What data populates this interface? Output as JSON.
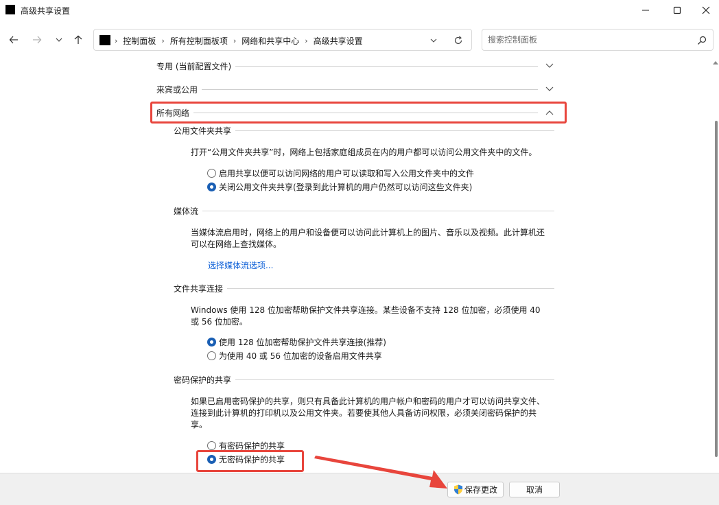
{
  "window": {
    "title": "高级共享设置"
  },
  "breadcrumb": [
    "控制面板",
    "所有控制面板项",
    "网络和共享中心",
    "高级共享设置"
  ],
  "search": {
    "placeholder": "搜索控制面板"
  },
  "profiles": {
    "private_label": "专用 (当前配置文件)",
    "guest_label": "来宾或公用",
    "all_label": "所有网络"
  },
  "public_folder": {
    "heading": "公用文件夹共享",
    "desc": "打开“公用文件夹共享”时，网络上包括家庭组成员在内的用户都可以访问公用文件夹中的文件。",
    "opt_on": "启用共享以便可以访问网络的用户可以读取和写入公用文件夹中的文件",
    "opt_off": "关闭公用文件夹共享(登录到此计算机的用户仍然可以访问这些文件夹)",
    "selected": "off"
  },
  "media": {
    "heading": "媒体流",
    "desc": "当媒体流启用时，网络上的用户和设备便可以访问此计算机上的图片、音乐以及视频。此计算机还可以在网络上查找媒体。",
    "link": "选择媒体流选项..."
  },
  "file_sharing": {
    "heading": "文件共享连接",
    "desc": "Windows 使用 128 位加密帮助保护文件共享连接。某些设备不支持 128 位加密，必须使用 40 或 56 位加密。",
    "opt_128": "使用 128 位加密帮助保护文件共享连接(推荐)",
    "opt_40": "为使用 40 或 56 位加密的设备启用文件共享",
    "selected": "128"
  },
  "password": {
    "heading": "密码保护的共享",
    "desc": "如果已启用密码保护的共享，则只有具备此计算机的用户帐户和密码的用户才可以访问共享文件、连接到此计算机的打印机以及公用文件夹。若要使其他人具备访问权限，必须关闭密码保护的共享。",
    "opt_on": "有密码保护的共享",
    "opt_off": "无密码保护的共享",
    "selected": "off"
  },
  "footer": {
    "save_label": "保存更改",
    "cancel_label": "取消"
  },
  "colors": {
    "highlight": "#e8453c",
    "radio_selected": "#1a5fb4",
    "link": "#0b5ed7"
  }
}
